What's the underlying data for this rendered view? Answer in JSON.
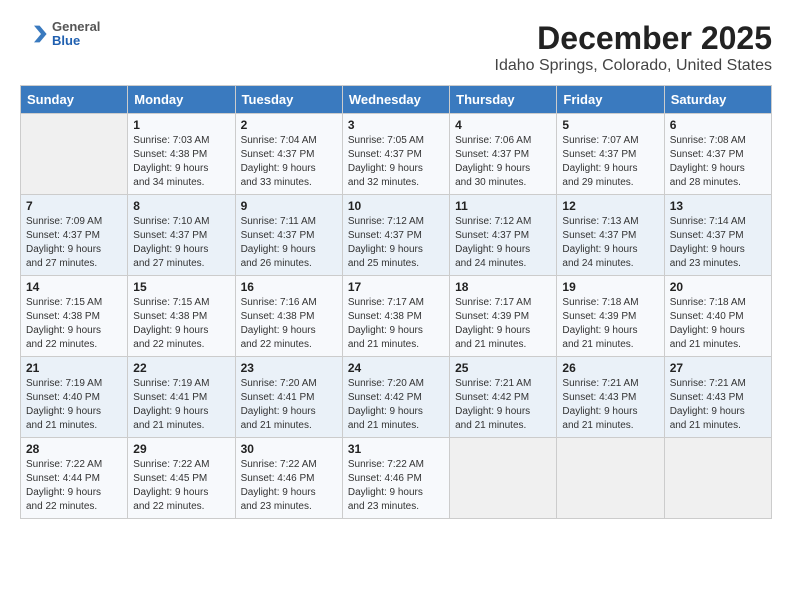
{
  "header": {
    "logo_general": "General",
    "logo_blue": "Blue",
    "title": "December 2025",
    "subtitle": "Idaho Springs, Colorado, United States"
  },
  "columns": [
    "Sunday",
    "Monday",
    "Tuesday",
    "Wednesday",
    "Thursday",
    "Friday",
    "Saturday"
  ],
  "weeks": [
    [
      {
        "day": "",
        "info": ""
      },
      {
        "day": "1",
        "info": "Sunrise: 7:03 AM\nSunset: 4:38 PM\nDaylight: 9 hours\nand 34 minutes."
      },
      {
        "day": "2",
        "info": "Sunrise: 7:04 AM\nSunset: 4:37 PM\nDaylight: 9 hours\nand 33 minutes."
      },
      {
        "day": "3",
        "info": "Sunrise: 7:05 AM\nSunset: 4:37 PM\nDaylight: 9 hours\nand 32 minutes."
      },
      {
        "day": "4",
        "info": "Sunrise: 7:06 AM\nSunset: 4:37 PM\nDaylight: 9 hours\nand 30 minutes."
      },
      {
        "day": "5",
        "info": "Sunrise: 7:07 AM\nSunset: 4:37 PM\nDaylight: 9 hours\nand 29 minutes."
      },
      {
        "day": "6",
        "info": "Sunrise: 7:08 AM\nSunset: 4:37 PM\nDaylight: 9 hours\nand 28 minutes."
      }
    ],
    [
      {
        "day": "7",
        "info": "Sunrise: 7:09 AM\nSunset: 4:37 PM\nDaylight: 9 hours\nand 27 minutes."
      },
      {
        "day": "8",
        "info": "Sunrise: 7:10 AM\nSunset: 4:37 PM\nDaylight: 9 hours\nand 27 minutes."
      },
      {
        "day": "9",
        "info": "Sunrise: 7:11 AM\nSunset: 4:37 PM\nDaylight: 9 hours\nand 26 minutes."
      },
      {
        "day": "10",
        "info": "Sunrise: 7:12 AM\nSunset: 4:37 PM\nDaylight: 9 hours\nand 25 minutes."
      },
      {
        "day": "11",
        "info": "Sunrise: 7:12 AM\nSunset: 4:37 PM\nDaylight: 9 hours\nand 24 minutes."
      },
      {
        "day": "12",
        "info": "Sunrise: 7:13 AM\nSunset: 4:37 PM\nDaylight: 9 hours\nand 24 minutes."
      },
      {
        "day": "13",
        "info": "Sunrise: 7:14 AM\nSunset: 4:37 PM\nDaylight: 9 hours\nand 23 minutes."
      }
    ],
    [
      {
        "day": "14",
        "info": "Sunrise: 7:15 AM\nSunset: 4:38 PM\nDaylight: 9 hours\nand 22 minutes."
      },
      {
        "day": "15",
        "info": "Sunrise: 7:15 AM\nSunset: 4:38 PM\nDaylight: 9 hours\nand 22 minutes."
      },
      {
        "day": "16",
        "info": "Sunrise: 7:16 AM\nSunset: 4:38 PM\nDaylight: 9 hours\nand 22 minutes."
      },
      {
        "day": "17",
        "info": "Sunrise: 7:17 AM\nSunset: 4:38 PM\nDaylight: 9 hours\nand 21 minutes."
      },
      {
        "day": "18",
        "info": "Sunrise: 7:17 AM\nSunset: 4:39 PM\nDaylight: 9 hours\nand 21 minutes."
      },
      {
        "day": "19",
        "info": "Sunrise: 7:18 AM\nSunset: 4:39 PM\nDaylight: 9 hours\nand 21 minutes."
      },
      {
        "day": "20",
        "info": "Sunrise: 7:18 AM\nSunset: 4:40 PM\nDaylight: 9 hours\nand 21 minutes."
      }
    ],
    [
      {
        "day": "21",
        "info": "Sunrise: 7:19 AM\nSunset: 4:40 PM\nDaylight: 9 hours\nand 21 minutes."
      },
      {
        "day": "22",
        "info": "Sunrise: 7:19 AM\nSunset: 4:41 PM\nDaylight: 9 hours\nand 21 minutes."
      },
      {
        "day": "23",
        "info": "Sunrise: 7:20 AM\nSunset: 4:41 PM\nDaylight: 9 hours\nand 21 minutes."
      },
      {
        "day": "24",
        "info": "Sunrise: 7:20 AM\nSunset: 4:42 PM\nDaylight: 9 hours\nand 21 minutes."
      },
      {
        "day": "25",
        "info": "Sunrise: 7:21 AM\nSunset: 4:42 PM\nDaylight: 9 hours\nand 21 minutes."
      },
      {
        "day": "26",
        "info": "Sunrise: 7:21 AM\nSunset: 4:43 PM\nDaylight: 9 hours\nand 21 minutes."
      },
      {
        "day": "27",
        "info": "Sunrise: 7:21 AM\nSunset: 4:43 PM\nDaylight: 9 hours\nand 21 minutes."
      }
    ],
    [
      {
        "day": "28",
        "info": "Sunrise: 7:22 AM\nSunset: 4:44 PM\nDaylight: 9 hours\nand 22 minutes."
      },
      {
        "day": "29",
        "info": "Sunrise: 7:22 AM\nSunset: 4:45 PM\nDaylight: 9 hours\nand 22 minutes."
      },
      {
        "day": "30",
        "info": "Sunrise: 7:22 AM\nSunset: 4:46 PM\nDaylight: 9 hours\nand 23 minutes."
      },
      {
        "day": "31",
        "info": "Sunrise: 7:22 AM\nSunset: 4:46 PM\nDaylight: 9 hours\nand 23 minutes."
      },
      {
        "day": "",
        "info": ""
      },
      {
        "day": "",
        "info": ""
      },
      {
        "day": "",
        "info": ""
      }
    ]
  ]
}
